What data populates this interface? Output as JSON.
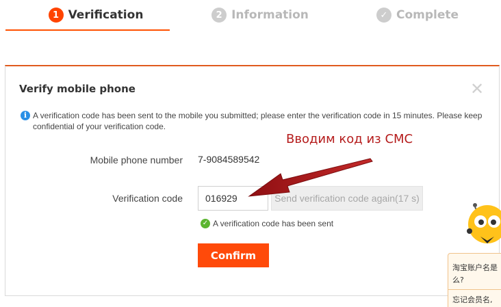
{
  "steps": [
    {
      "number": "1",
      "label": "Verification"
    },
    {
      "number": "2",
      "label": "Information"
    },
    {
      "number": "✓",
      "label": "Complete"
    }
  ],
  "dialog": {
    "title": "Verify mobile phone",
    "close_symbol": "✕",
    "notice": "A verification code has been sent to the mobile you submitted; please enter the verification code in 15 minutes. Please keep confidential of your verification code.",
    "phone_label": "Mobile phone number",
    "phone_value": "7-9084589542",
    "code_label": "Verification code",
    "code_value": "016929",
    "resend_label": "Send verification code again(17 s)",
    "sent_message": "A verification code has been sent",
    "confirm_label": "Confirm"
  },
  "annotation": {
    "text": "Вводим код из СМС"
  },
  "help": {
    "question": "淘宝账户名是什么?",
    "question_line1": "淘宝账户名是",
    "question_line2": "么?",
    "forgot": "忘记会员名,"
  },
  "icons": {
    "info": "info-circle-icon",
    "check": "check-circle-icon",
    "close": "close-icon",
    "mascot": "mascot-assistant-icon"
  },
  "colors": {
    "accent": "#ff4400",
    "annotation": "#b51c1c",
    "success": "#5cb531",
    "info": "#2a90e6"
  }
}
